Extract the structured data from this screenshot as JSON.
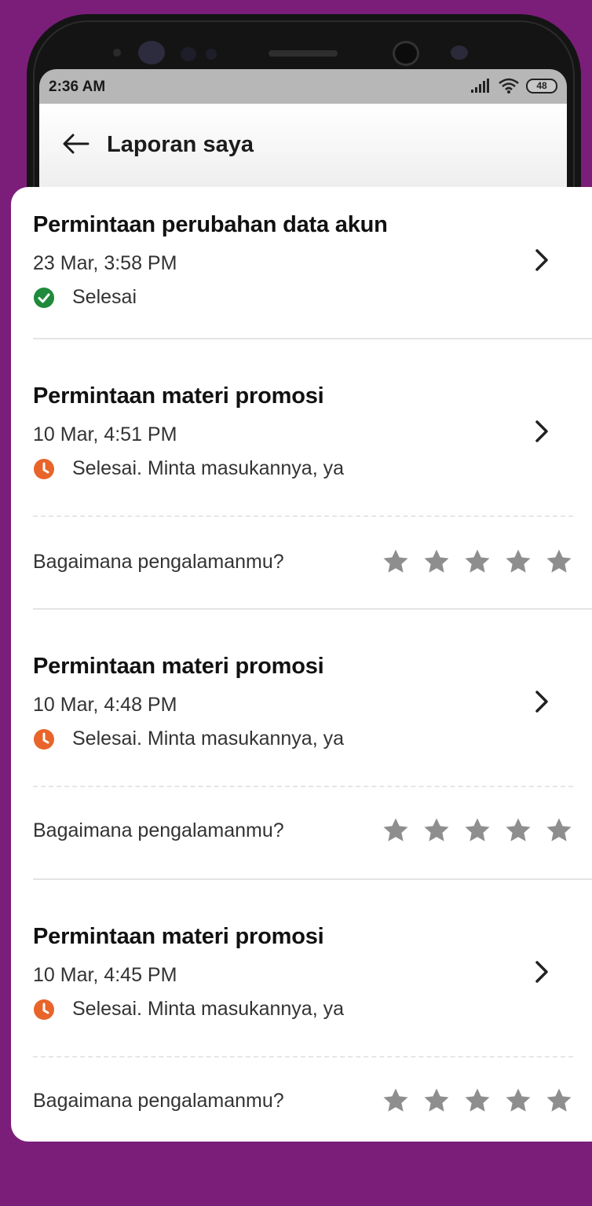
{
  "statusbar": {
    "time": "2:36 AM",
    "battery": "48"
  },
  "appbar": {
    "title": "Laporan saya"
  },
  "colors": {
    "background": "#7b1e7a",
    "done_green": "#1f8a3b",
    "pending_orange": "#e8642a",
    "star_gray": "#8e8e8e"
  },
  "reports": [
    {
      "title": "Permintaan perubahan data akun",
      "date": "23 Mar, 3:58 PM",
      "status": "Selesai",
      "status_icon": "check-circle-icon",
      "rating_prompt": null
    },
    {
      "title": "Permintaan materi promosi",
      "date": "10 Mar, 4:51 PM",
      "status": "Selesai. Minta masukannya, ya",
      "status_icon": "clock-icon",
      "rating_prompt": "Bagaimana pengalamanmu?",
      "rating": 0
    },
    {
      "title": "Permintaan materi promosi",
      "date": "10 Mar, 4:48 PM",
      "status": "Selesai. Minta masukannya, ya",
      "status_icon": "clock-icon",
      "rating_prompt": "Bagaimana pengalamanmu?",
      "rating": 0
    },
    {
      "title": "Permintaan materi promosi",
      "date": "10 Mar, 4:45 PM",
      "status": "Selesai. Minta masukannya, ya",
      "status_icon": "clock-icon",
      "rating_prompt": "Bagaimana pengalamanmu?",
      "rating": 0
    }
  ]
}
